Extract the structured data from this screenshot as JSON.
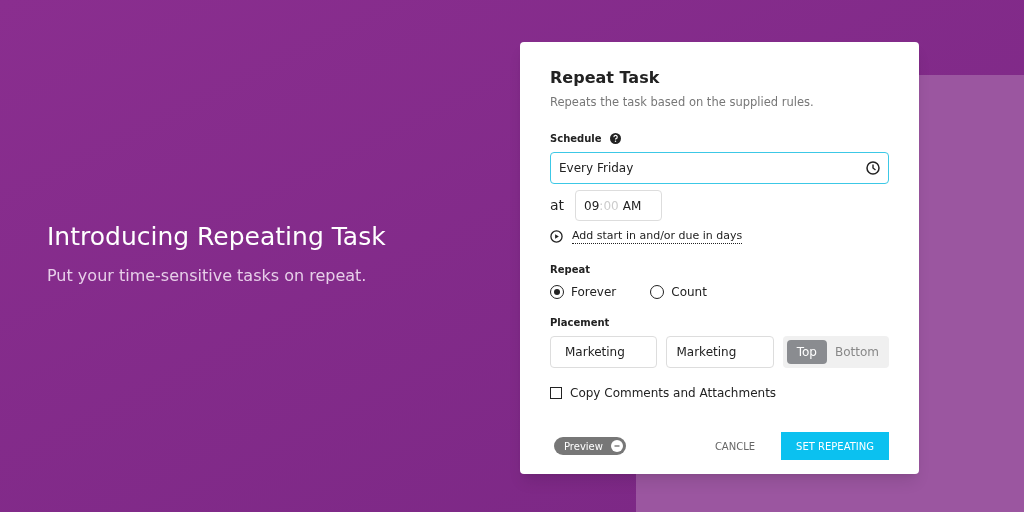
{
  "hero": {
    "title": "Introducing Repeating Task",
    "subtitle": "Put your time-sensitive tasks on repeat."
  },
  "dialog": {
    "title": "Repeat Task",
    "description": "Repeats the task based on the supplied rules.",
    "schedule": {
      "label": "Schedule",
      "value": "Every Friday",
      "at_label": "at",
      "time": {
        "hours": "09",
        "minutes": ":00",
        "period": "AM"
      },
      "link": "Add start in and/or due in days"
    },
    "repeat": {
      "label": "Repeat",
      "options": [
        {
          "label": "Forever",
          "selected": true
        },
        {
          "label": "Count",
          "selected": false
        }
      ]
    },
    "placement": {
      "label": "Placement",
      "fields": [
        "Marketing",
        "Marketing"
      ],
      "positions": [
        {
          "label": "Top",
          "selected": true
        },
        {
          "label": "Bottom",
          "selected": false
        }
      ]
    },
    "copy_option": {
      "label": "Copy Comments and Attachments",
      "checked": false
    },
    "preview": {
      "label": "Preview"
    },
    "buttons": [
      {
        "label": "CANCLE",
        "kind": "text"
      },
      {
        "label": "SET REPEATING",
        "kind": "primary"
      }
    ]
  }
}
